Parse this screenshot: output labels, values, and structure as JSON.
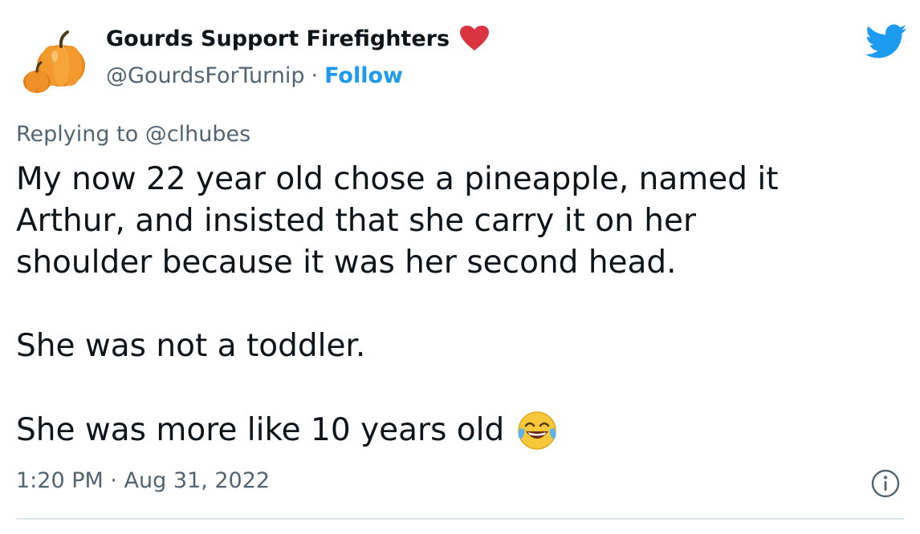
{
  "author": {
    "display_name": "Gourds Support Firefighters",
    "handle": "@GourdsForTurnip",
    "separator": "·",
    "follow_label": "Follow",
    "avatar_icon": "pumpkin-avatar-icon",
    "badge_icon": "red-heart-icon"
  },
  "colors": {
    "follow": "#1d9bf0",
    "muted": "#536471",
    "text": "#0f1419",
    "heart": "#d9343f",
    "twitter": "#1d9bf0"
  },
  "reply": {
    "text": "Replying to @clhubes"
  },
  "tweet": {
    "paragraph_1": "My now 22 year old chose a pineapple, named it\nArthur, and insisted that she carry it on her\nshoulder because it was her second head.",
    "paragraph_2": "She was not a toddler.",
    "paragraph_3": "She was more like 10 years old",
    "emoji_icon": "face-with-tears-of-joy-icon"
  },
  "meta": {
    "timestamp": "1:20 PM · Aug 31, 2022",
    "info_icon": "info-icon",
    "brand_icon": "twitter-bird-icon"
  }
}
